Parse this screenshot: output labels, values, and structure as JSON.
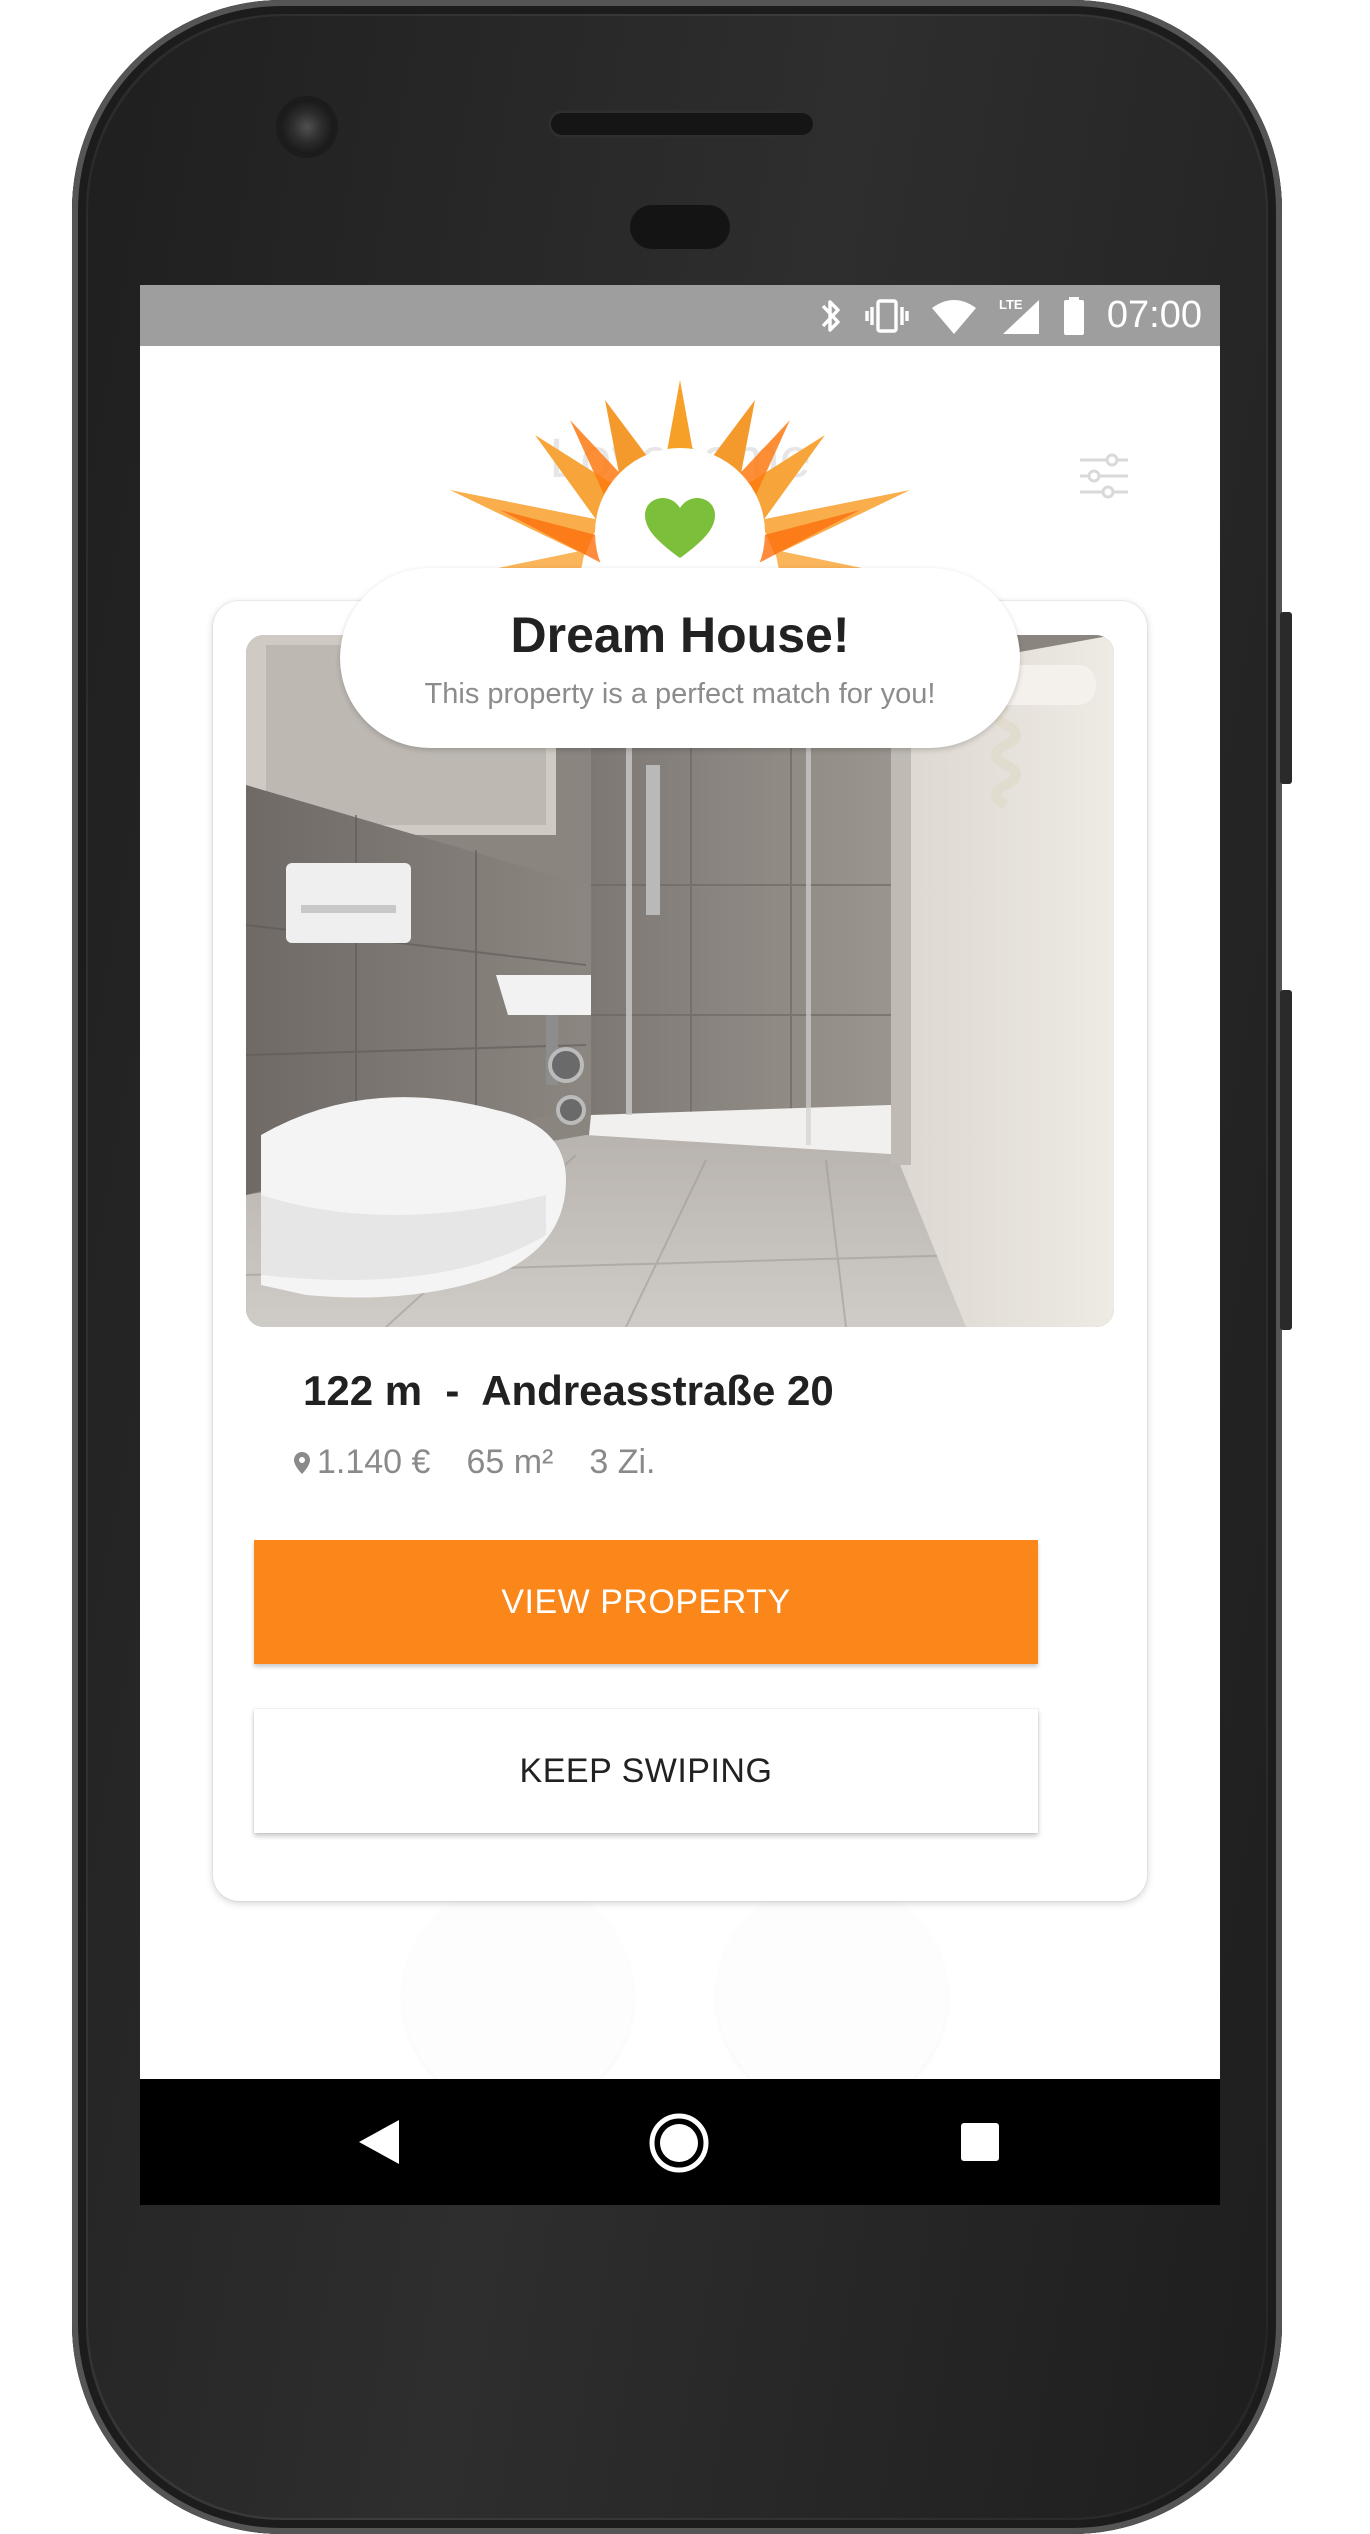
{
  "status_bar": {
    "time": "07:00",
    "network": "LTE",
    "icons": [
      "bluetooth-icon",
      "vibrate-icon",
      "wifi-icon",
      "cell-signal-icon",
      "battery-icon"
    ]
  },
  "app_bar": {
    "title": "Lovehome",
    "filter_icon": "sliders-icon"
  },
  "match_popup": {
    "title": "Dream House!",
    "subtitle": "This property is a perfect match for you!",
    "icon": "heart-icon",
    "colors": {
      "burst": "#fb8619",
      "heart": "#7cbf3a"
    }
  },
  "listing": {
    "title": "122 m  -  Andreasstraße 20",
    "price": "1.140 €",
    "area": "65 m²",
    "rooms": "3 Zi.",
    "photo": "bathroom-photo"
  },
  "buttons": {
    "view_property": "VIEW PROPERTY",
    "keep_swiping": "KEEP SWIPING"
  },
  "colors": {
    "accent": "#fb8619",
    "status_bar": "#9e9e9e",
    "nav_bar": "#000000"
  },
  "nav_bar": {
    "icons": [
      "back-icon",
      "home-icon",
      "recents-icon"
    ]
  }
}
